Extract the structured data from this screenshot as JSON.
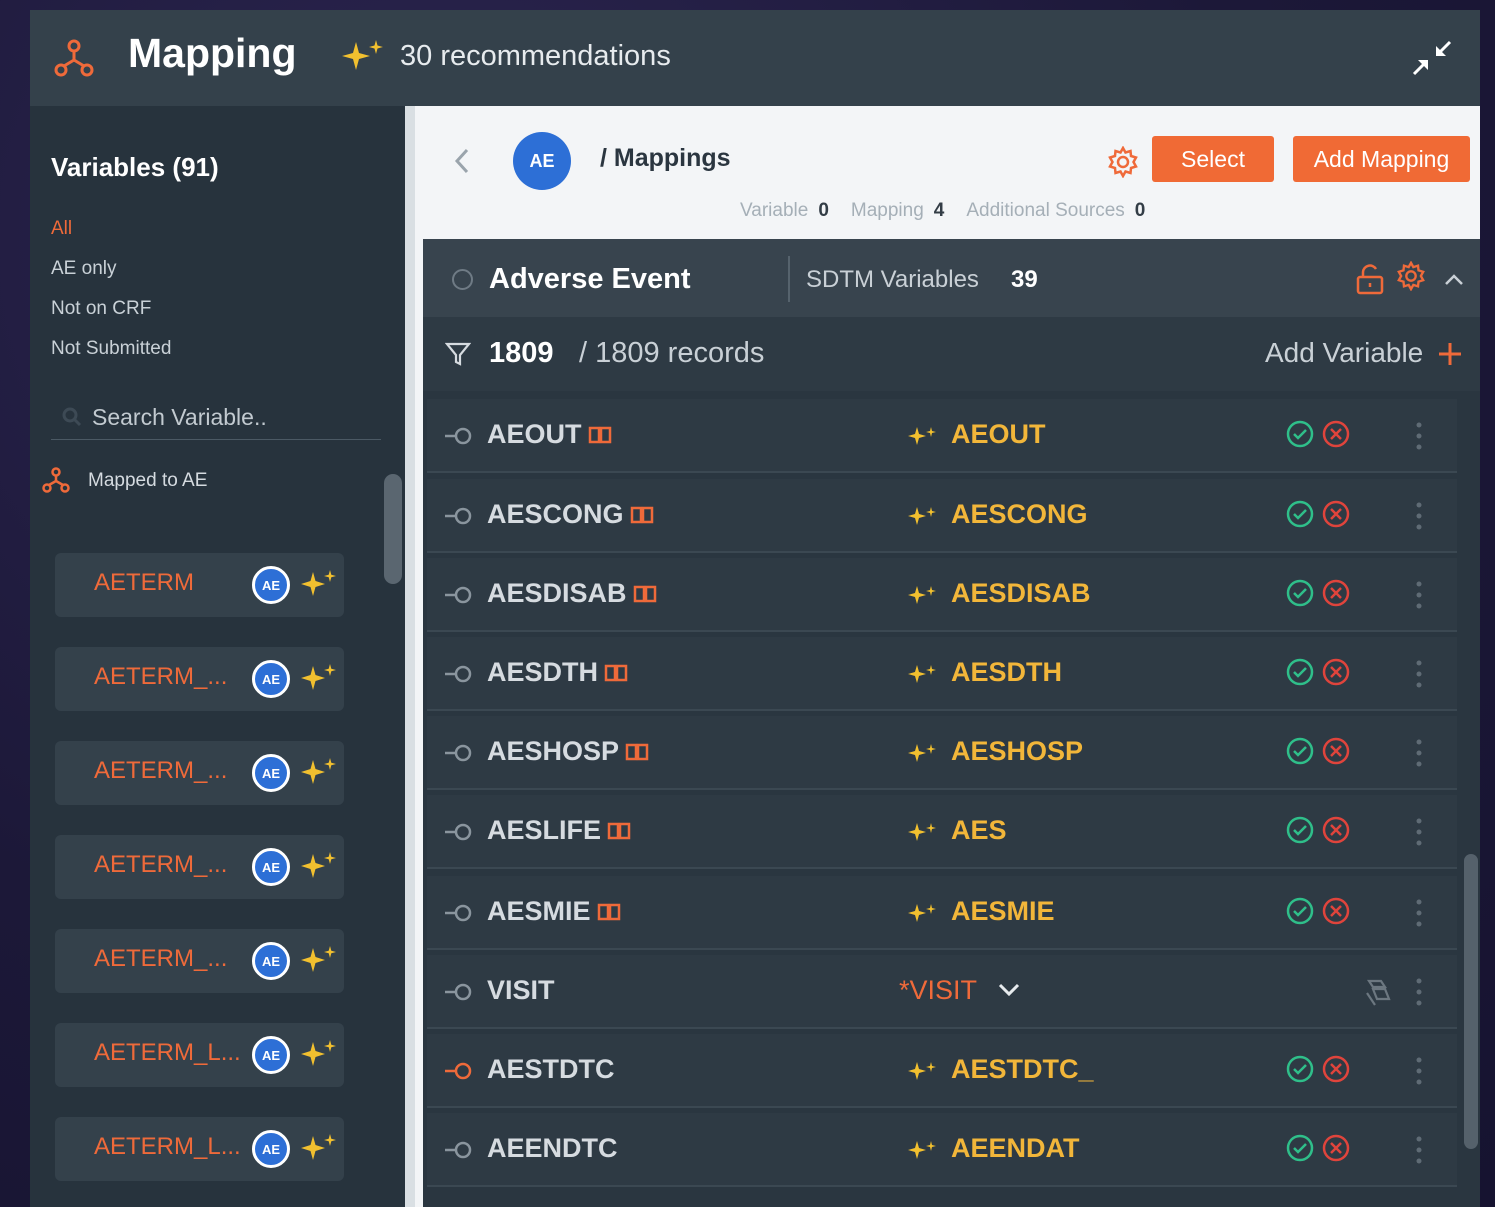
{
  "header": {
    "title": "Mapping",
    "recommendations": "30 recommendations"
  },
  "sidebar": {
    "title": "Variables (91)",
    "filters": [
      {
        "label": "All",
        "active": true
      },
      {
        "label": "AE only",
        "active": false
      },
      {
        "label": "Not on CRF",
        "active": false
      },
      {
        "label": "Not Submitted",
        "active": false
      }
    ],
    "search_placeholder": "Search Variable..",
    "mapped_label": "Mapped to AE",
    "variables": [
      {
        "name": "AETERM",
        "badge": "AE"
      },
      {
        "name": "AETERM_...",
        "badge": "AE"
      },
      {
        "name": "AETERM_...",
        "badge": "AE"
      },
      {
        "name": "AETERM_...",
        "badge": "AE"
      },
      {
        "name": "AETERM_...",
        "badge": "AE"
      },
      {
        "name": "AETERM_L...",
        "badge": "AE"
      },
      {
        "name": "AETERM_L...",
        "badge": "AE"
      }
    ]
  },
  "main": {
    "badge": "AE",
    "breadcrumb": "/ Mappings",
    "select_label": "Select",
    "add_mapping_label": "Add Mapping",
    "counts": {
      "variable_label": "Variable",
      "variable_value": "0",
      "mapping_label": "Mapping",
      "mapping_value": "4",
      "sources_label": "Additional Sources",
      "sources_value": "0"
    }
  },
  "domain": {
    "name": "Adverse Event",
    "sdtm_label": "SDTM Variables",
    "sdtm_count": "39",
    "records_filtered": "1809",
    "records_total": "/ 1809 records",
    "add_variable_label": "Add Variable"
  },
  "rows": [
    {
      "source": "AEOUT",
      "target": "AEOUT",
      "book": true,
      "type": "recommend"
    },
    {
      "source": "AESCONG",
      "target": "AESCONG",
      "book": true,
      "type": "recommend"
    },
    {
      "source": "AESDISAB",
      "target": "AESDISAB",
      "book": true,
      "type": "recommend"
    },
    {
      "source": "AESDTH",
      "target": "AESDTH",
      "book": true,
      "type": "recommend"
    },
    {
      "source": "AESHOSP",
      "target": "AESHOSP",
      "book": true,
      "type": "recommend"
    },
    {
      "source": "AESLIFE",
      "target": "AES",
      "book": true,
      "type": "recommend"
    },
    {
      "source": "AESMIE",
      "target": "AESMIE",
      "book": true,
      "type": "recommend"
    },
    {
      "source": "VISIT",
      "target": "*VISIT",
      "book": false,
      "type": "select"
    },
    {
      "source": "AESTDTC",
      "target": "AESTDTC_",
      "book": false,
      "type": "recommend",
      "link_active": true
    },
    {
      "source": "AEENDTC",
      "target": "AEENDAT",
      "book": false,
      "type": "recommend"
    }
  ],
  "colors": {
    "accent": "#ef6a3a",
    "recommend": "#f2b63a",
    "ok": "#2fbf8a",
    "reject": "#e0443c",
    "badge": "#2d6fd6"
  }
}
